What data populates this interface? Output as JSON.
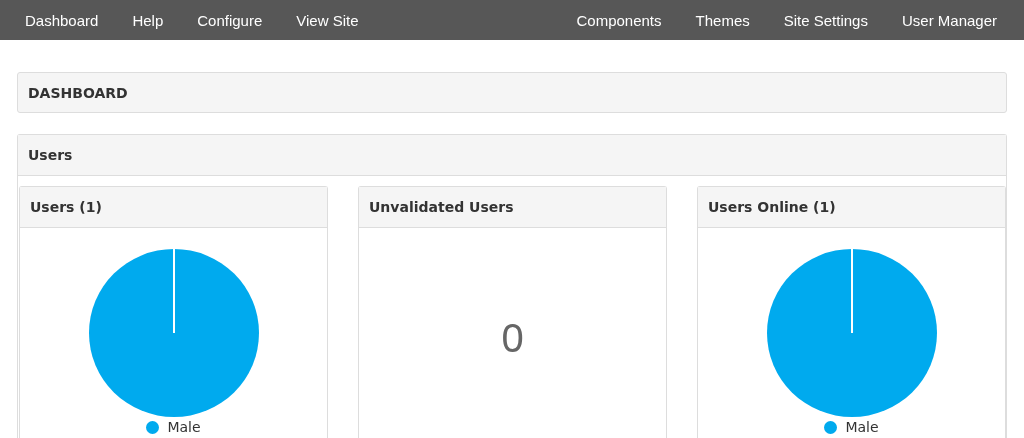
{
  "nav": {
    "left": [
      "Dashboard",
      "Help",
      "Configure",
      "View Site"
    ],
    "right": [
      "Components",
      "Themes",
      "Site Settings",
      "User Manager"
    ]
  },
  "page_title": "DASHBOARD",
  "section": {
    "title": "Users",
    "cards": [
      {
        "title": "Users (1)",
        "kind": "pie",
        "legend": [
          {
            "label": "Male",
            "color": "#00aaee"
          }
        ]
      },
      {
        "title": "Unvalidated Users",
        "kind": "count",
        "value": "0"
      },
      {
        "title": "Users Online (1)",
        "kind": "pie",
        "legend": [
          {
            "label": "Male",
            "color": "#00aaee"
          }
        ]
      }
    ]
  }
}
